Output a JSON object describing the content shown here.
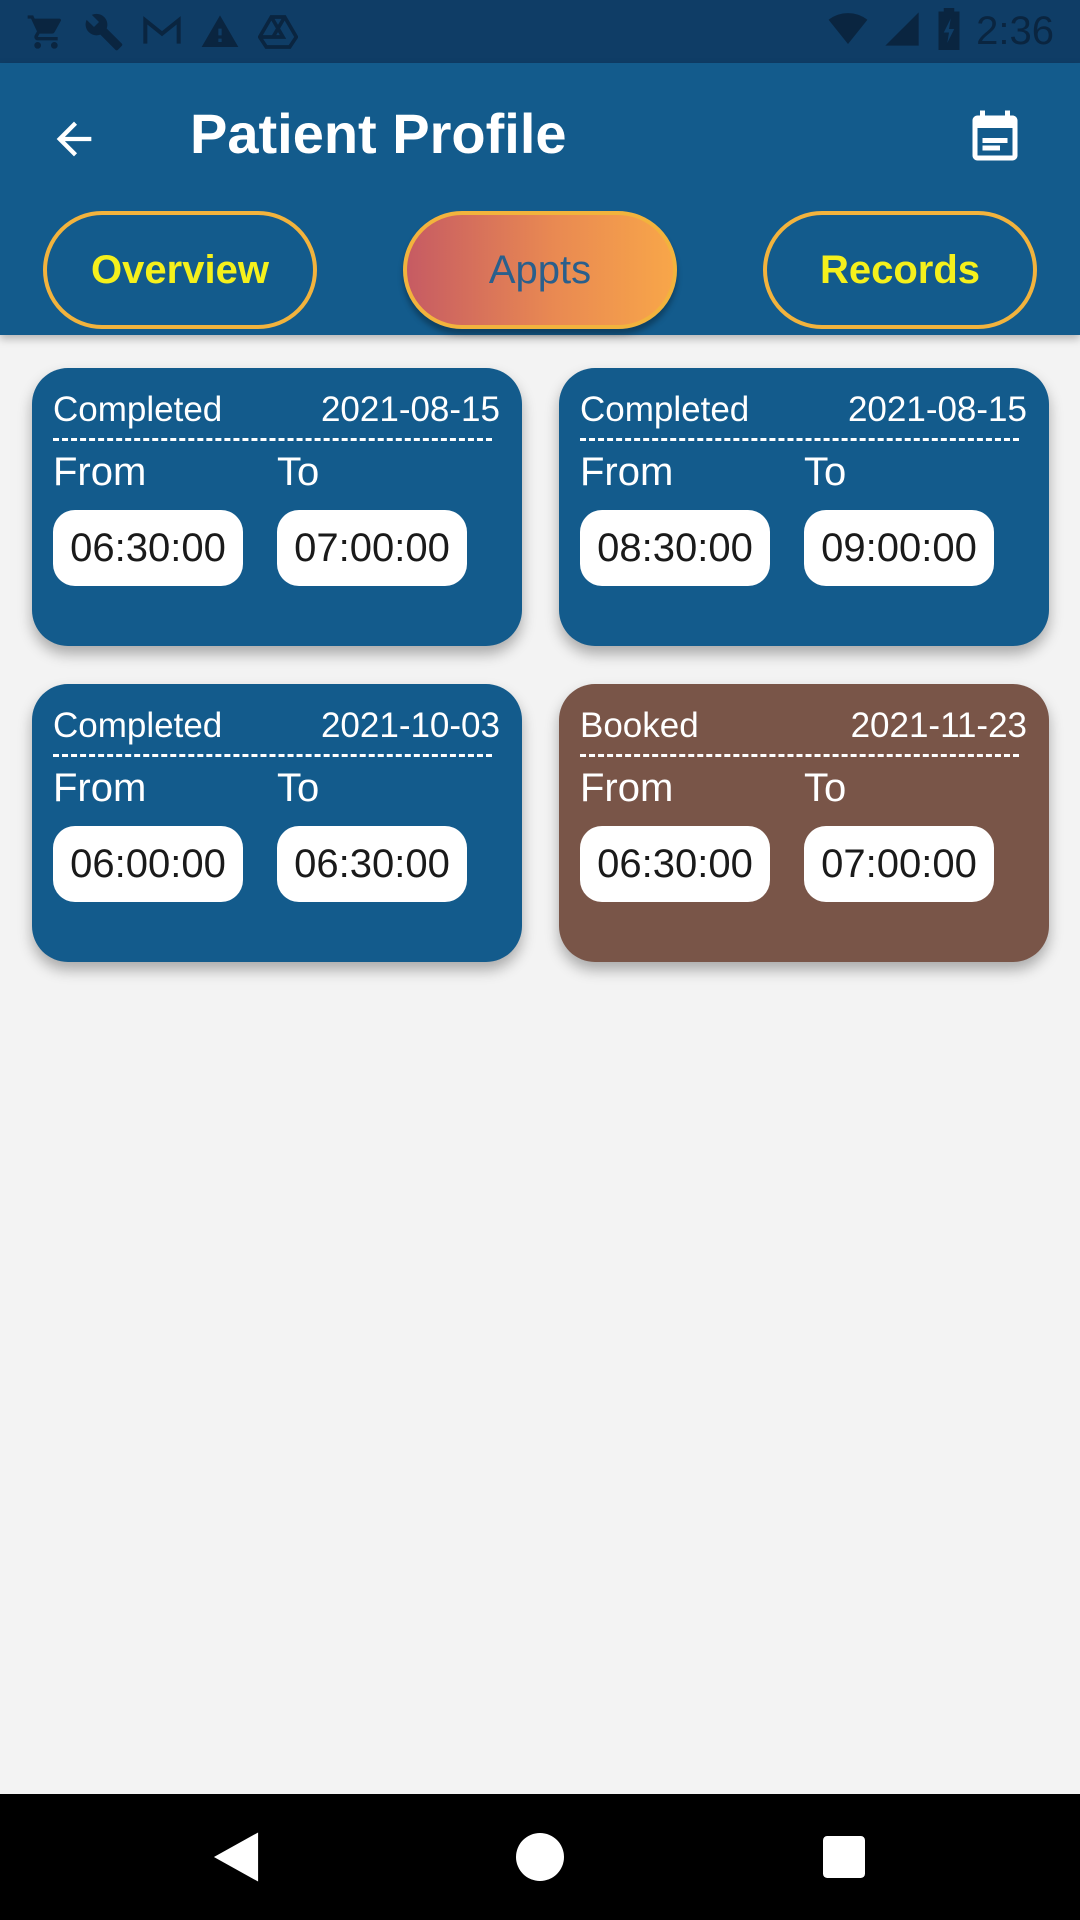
{
  "status_bar": {
    "time": "2:36",
    "icons": [
      "cart-icon",
      "wrench-icon",
      "gmail-icon",
      "warning-icon",
      "drive-icon",
      "wifi-icon",
      "signal-icon",
      "battery-icon"
    ]
  },
  "header": {
    "title": "Patient Profile",
    "back_icon": "arrow-left-icon",
    "calendar_icon": "calendar-icon"
  },
  "tabs": [
    {
      "label": "Overview",
      "selected": false
    },
    {
      "label": "Appts",
      "selected": true
    },
    {
      "label": "Records",
      "selected": false
    }
  ],
  "labels": {
    "from": "From",
    "to": "To"
  },
  "appointments": [
    {
      "status": "Completed",
      "date": "2021-08-15",
      "from": "06:30:00",
      "to": "07:00:00",
      "color": "#135b8c"
    },
    {
      "status": "Completed",
      "date": "2021-08-15",
      "from": "08:30:00",
      "to": "09:00:00",
      "color": "#135b8c"
    },
    {
      "status": "Completed",
      "date": "2021-10-03",
      "from": "06:00:00",
      "to": "06:30:00",
      "color": "#135b8c"
    },
    {
      "status": "Booked",
      "date": "2021-11-23",
      "from": "06:30:00",
      "to": "07:00:00",
      "color": "#795548"
    }
  ],
  "colors": {
    "app_bar": "#135b8c",
    "status_bar": "#0f3d66",
    "tab_border": "#f2b33d",
    "tab_text": "#f5f01c",
    "booked": "#795548"
  },
  "nav": {
    "icons": [
      "nav-back-icon",
      "nav-home-icon",
      "nav-recents-icon"
    ]
  }
}
